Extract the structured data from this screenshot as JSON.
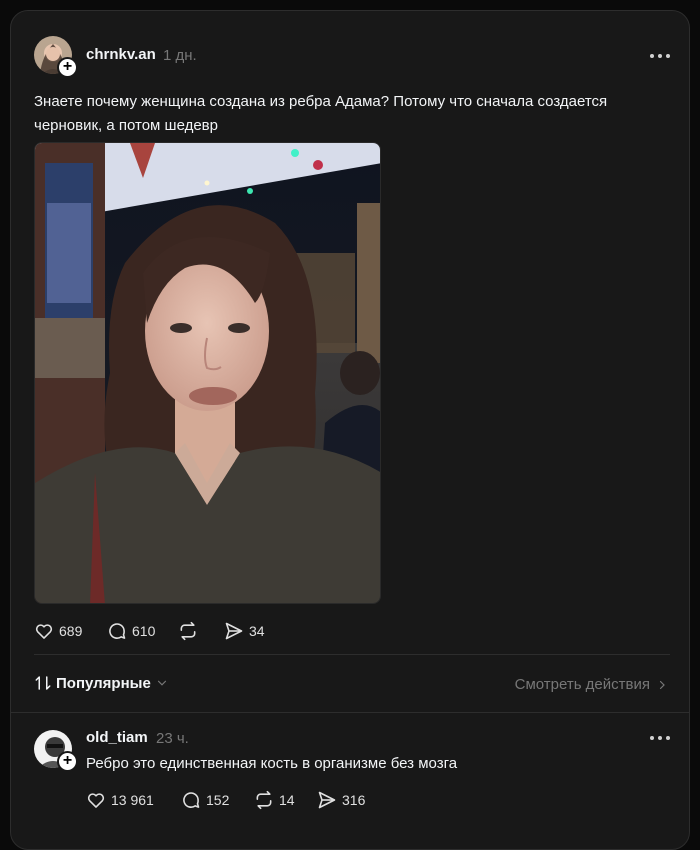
{
  "post": {
    "username": "chrnkv.an",
    "time": "1 дн.",
    "text_line1": "Знаете почему женщина создана из ребра Адама? Потому что сначала создается",
    "text_line2": "черновик, а потом шедевр",
    "likes": "689",
    "comments": "610",
    "shares": "34"
  },
  "replies_bar": {
    "sort_label": "Популярные",
    "view_activity_label": "Смотреть действия"
  },
  "reply": {
    "username": "old_tiam",
    "time": "23 ч.",
    "text": "Ребро это единственная кость в организме без мозга",
    "likes": "13 961",
    "comments": "152",
    "reposts": "14",
    "shares": "316"
  },
  "icons": {
    "like": "heart-icon",
    "comment": "comment-bubble-icon",
    "repost": "repost-icon",
    "share": "send-icon",
    "more": "more-dots-icon",
    "follow": "plus-icon",
    "sort": "sort-arrows-icon"
  },
  "colors": {
    "background": "#0a0a0a",
    "panel": "#181818",
    "text_primary": "#f3f5f7",
    "text_secondary": "#777777"
  }
}
